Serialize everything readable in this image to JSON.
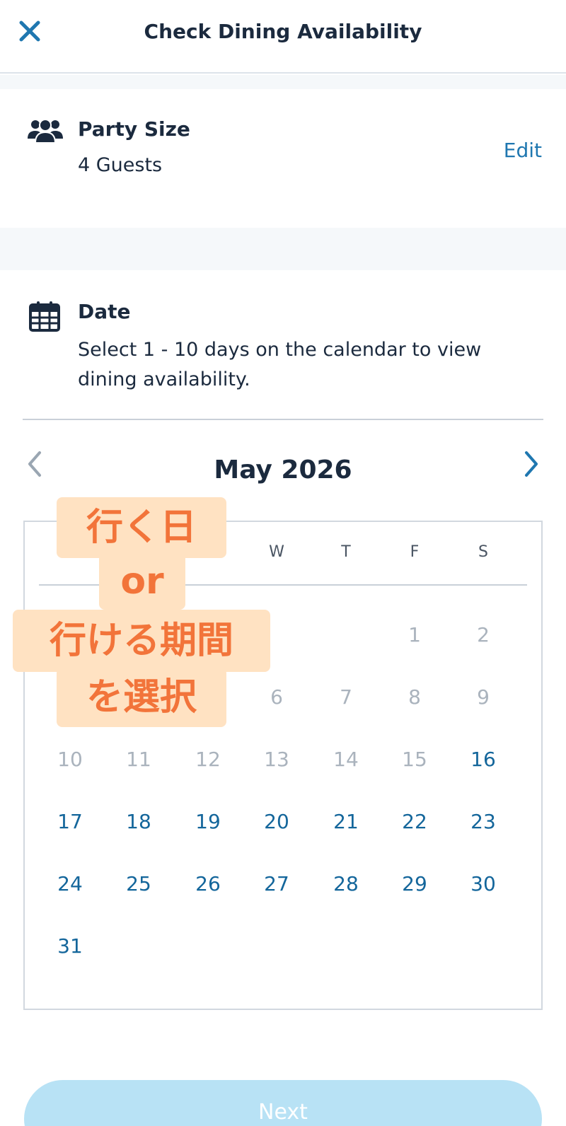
{
  "header": {
    "title": "Check Dining Availability",
    "close_icon": "close-icon",
    "accent_color": "#1f77b0"
  },
  "party": {
    "label": "Party Size",
    "value": "4 Guests",
    "edit_label": "Edit",
    "icon": "people-icon"
  },
  "date": {
    "label": "Date",
    "description": "Select 1 - 10 days on the calendar to view dining availability.",
    "icon": "calendar-icon"
  },
  "calendar": {
    "month_title": "May 2026",
    "weekdays": [
      "",
      "",
      "",
      "W",
      "T",
      "F",
      "S"
    ],
    "weeks": [
      [
        {
          "day": "",
          "state": "empty"
        },
        {
          "day": "",
          "state": "empty"
        },
        {
          "day": "",
          "state": "empty"
        },
        {
          "day": "",
          "state": "empty"
        },
        {
          "day": "",
          "state": "empty"
        },
        {
          "day": "1",
          "state": "disabled"
        },
        {
          "day": "2",
          "state": "disabled"
        }
      ],
      [
        {
          "day": "",
          "state": "empty"
        },
        {
          "day": "",
          "state": "empty"
        },
        {
          "day": "",
          "state": "empty"
        },
        {
          "day": "6",
          "state": "disabled"
        },
        {
          "day": "7",
          "state": "disabled"
        },
        {
          "day": "8",
          "state": "disabled"
        },
        {
          "day": "9",
          "state": "disabled"
        }
      ],
      [
        {
          "day": "10",
          "state": "disabled"
        },
        {
          "day": "11",
          "state": "disabled"
        },
        {
          "day": "12",
          "state": "disabled"
        },
        {
          "day": "13",
          "state": "disabled"
        },
        {
          "day": "14",
          "state": "disabled"
        },
        {
          "day": "15",
          "state": "disabled"
        },
        {
          "day": "16",
          "state": "available"
        }
      ],
      [
        {
          "day": "17",
          "state": "available"
        },
        {
          "day": "18",
          "state": "available"
        },
        {
          "day": "19",
          "state": "available"
        },
        {
          "day": "20",
          "state": "available"
        },
        {
          "day": "21",
          "state": "available"
        },
        {
          "day": "22",
          "state": "available"
        },
        {
          "day": "23",
          "state": "available"
        }
      ],
      [
        {
          "day": "24",
          "state": "available"
        },
        {
          "day": "25",
          "state": "available"
        },
        {
          "day": "26",
          "state": "available"
        },
        {
          "day": "27",
          "state": "available"
        },
        {
          "day": "28",
          "state": "available"
        },
        {
          "day": "29",
          "state": "available"
        },
        {
          "day": "30",
          "state": "available"
        }
      ],
      [
        {
          "day": "31",
          "state": "available"
        },
        {
          "day": "",
          "state": "empty"
        },
        {
          "day": "",
          "state": "empty"
        },
        {
          "day": "",
          "state": "empty"
        },
        {
          "day": "",
          "state": "empty"
        },
        {
          "day": "",
          "state": "empty"
        },
        {
          "day": "",
          "state": "empty"
        }
      ]
    ],
    "prev_icon": "chevron-left-icon",
    "next_icon": "chevron-right-icon",
    "available_color": "#14669b",
    "disabled_color": "#aab3bd"
  },
  "annotation": {
    "lines": [
      "行く日",
      "or",
      "行ける期間",
      "を選択"
    ],
    "text_color": "#f2743a",
    "background_color": "#ffe2c2"
  },
  "footer": {
    "next_label": "Next",
    "button_color": "#b8e2f5"
  }
}
